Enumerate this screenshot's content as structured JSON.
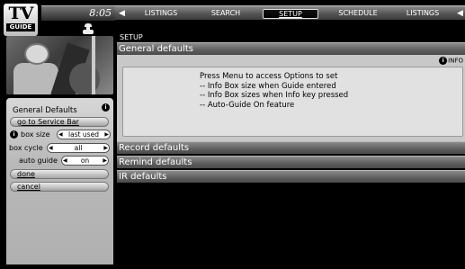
{
  "logo": {
    "line1": "TV",
    "line2": "GUIDE"
  },
  "clock": "8:05",
  "nav": {
    "left_arrow": "◀",
    "right_arrow": "◀",
    "tabs": [
      {
        "label": "LISTINGS",
        "active": false
      },
      {
        "label": "SEARCH",
        "active": false
      },
      {
        "label": "SETUP",
        "active": true
      },
      {
        "label": "SCHEDULE",
        "active": false
      },
      {
        "label": "LISTINGS",
        "active": false
      }
    ]
  },
  "breadcrumb": "SETUP",
  "side_panel": {
    "title": "General Defaults",
    "info_symbol": "i",
    "service_bar_button": "go to Service Bar",
    "box_size_label": "box size",
    "box_size_value": "last used",
    "box_cycle_label": "box cycle",
    "box_cycle_value": "all",
    "auto_guide_label": "auto guide",
    "auto_guide_value": "on",
    "done_button": "done",
    "cancel_button": "cancel"
  },
  "sections": {
    "general": {
      "title": "General defaults",
      "info_label": "INFO",
      "message_lines": [
        "Press Menu to access Options to set",
        "-- Info Box size when Guide entered",
        "-- Info Box sizes when Info key pressed",
        "-- Auto-Guide On feature"
      ]
    },
    "record": {
      "title": "Record defaults"
    },
    "remind": {
      "title": "Remind defaults"
    },
    "ir": {
      "title": "IR defaults"
    }
  }
}
